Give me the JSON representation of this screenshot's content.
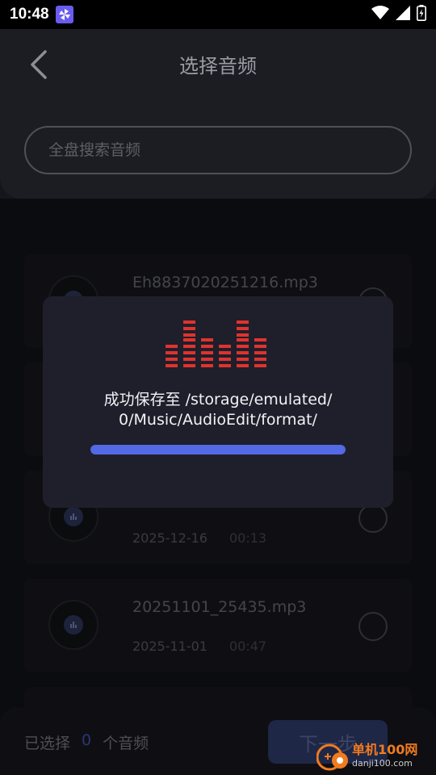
{
  "status": {
    "time": "10:48"
  },
  "header": {
    "title": "选择音频"
  },
  "search": {
    "placeholder": "全盘搜索音频"
  },
  "list": {
    "items": [
      {
        "name": "Eh8837020251216.mp3",
        "date": "",
        "duration": ""
      },
      {
        "name": "",
        "date": "2025-12-16",
        "duration": "00:13"
      },
      {
        "name": "20251101_25435.mp3",
        "date": "2025-11-01",
        "duration": "00:47"
      }
    ]
  },
  "bottom": {
    "selected_prefix": "已选择",
    "selected_count": "0",
    "selected_suffix": "个音频",
    "next_label": "下一步"
  },
  "dialog": {
    "line1": "成功保存至 /storage/emulated/",
    "line2": "0/Music/AudioEdit/format/",
    "progress": 1.0
  },
  "watermark": {
    "name": "单机100网",
    "url": "danji100.com"
  },
  "colors": {
    "accent": "#5369e6",
    "eq": "#e0332e",
    "watermark": "#f07b1f"
  }
}
